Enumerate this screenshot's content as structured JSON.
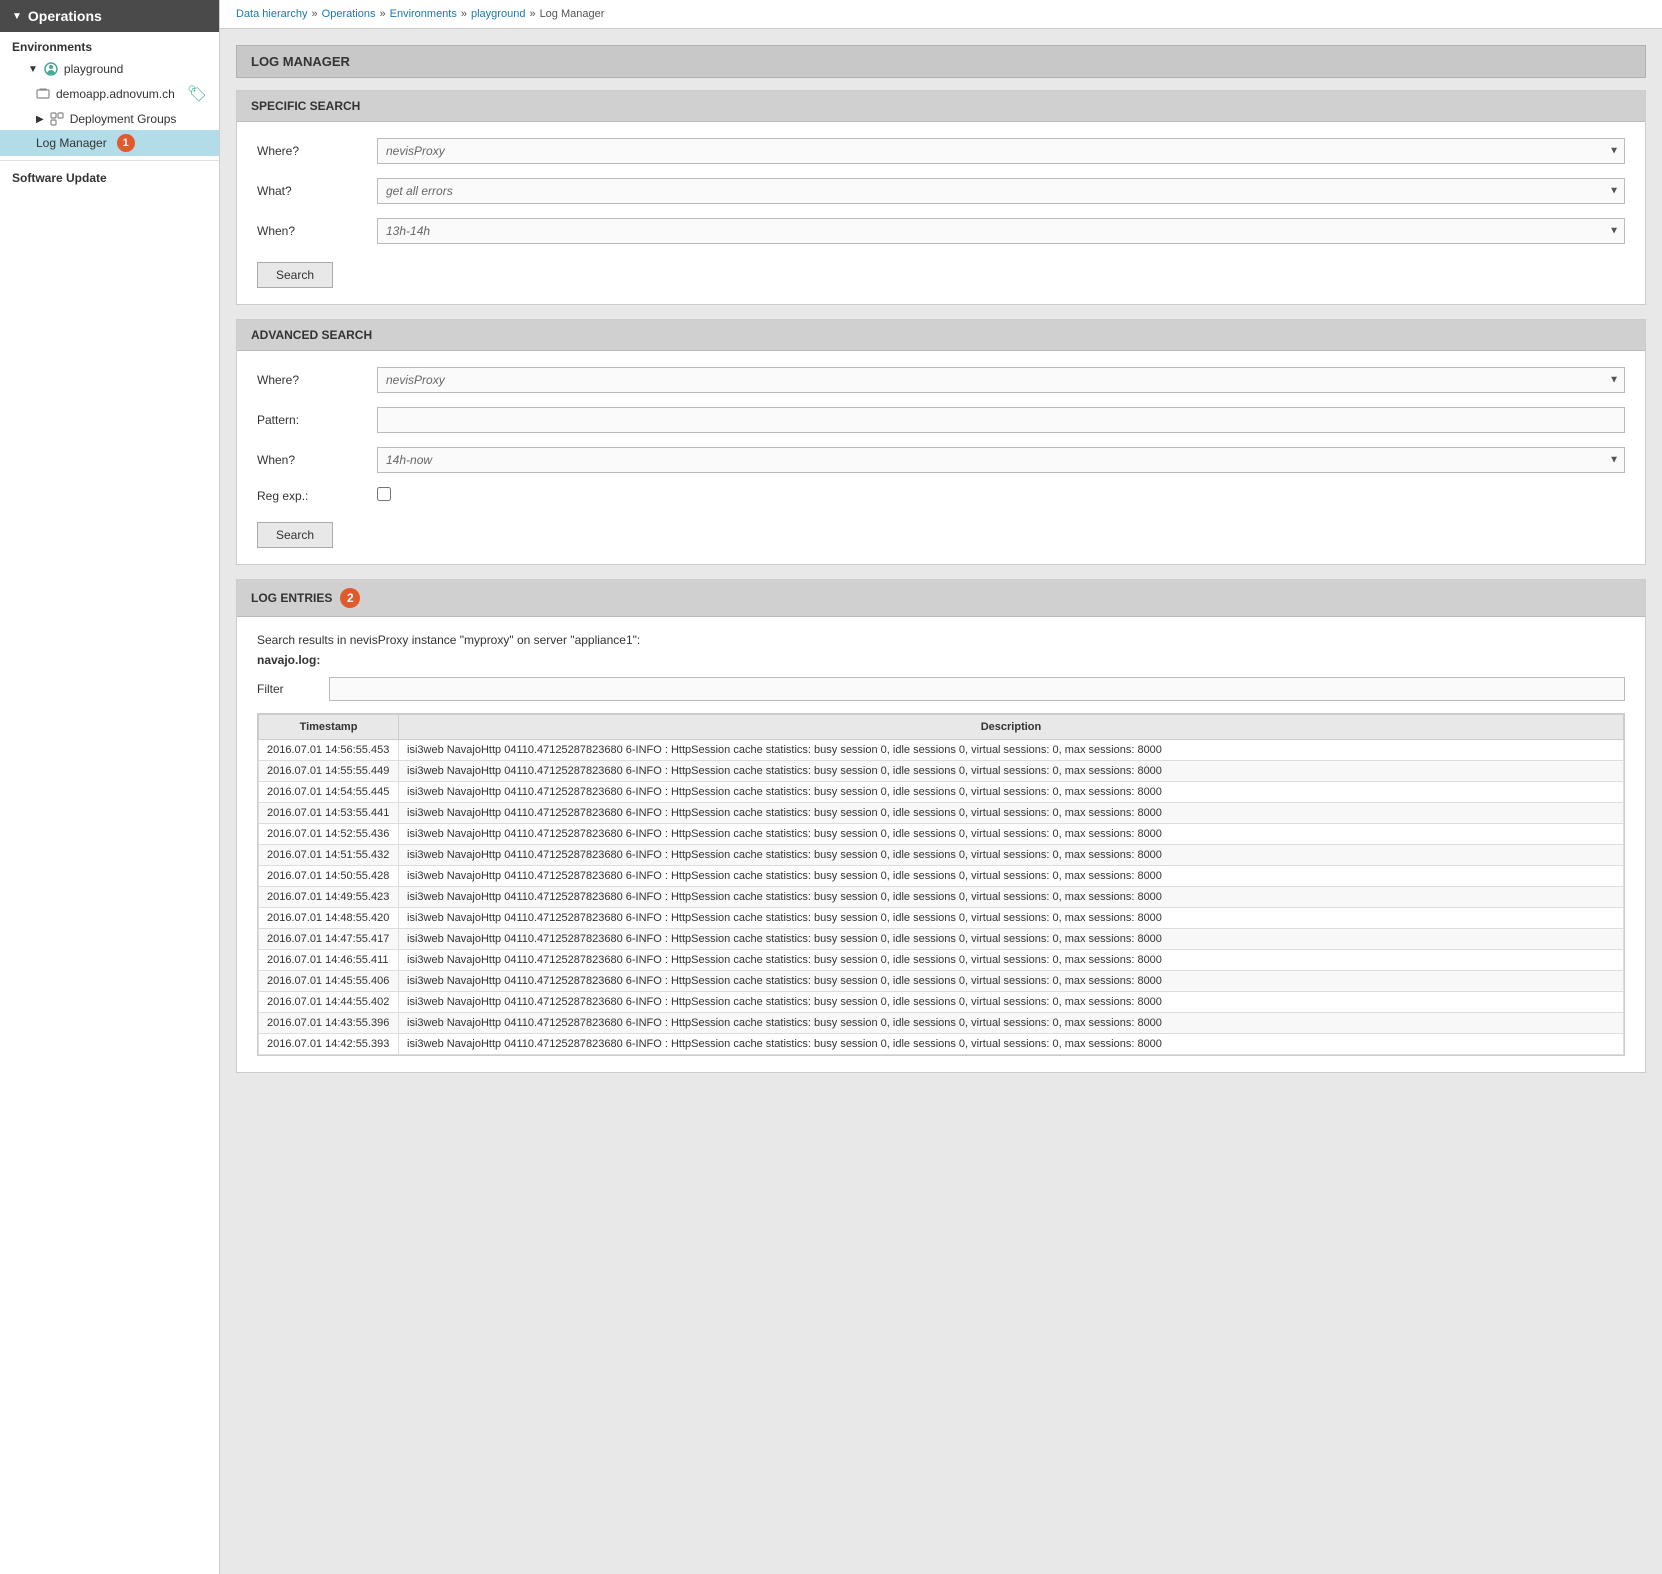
{
  "sidebar": {
    "header": "Operations",
    "environments_label": "Environments",
    "playground_label": "playground",
    "demoapp_label": "demoapp.adnovum.ch",
    "deployment_groups_label": "Deployment Groups",
    "log_manager_label": "Log Manager",
    "log_manager_badge": "1",
    "software_update_label": "Software Update"
  },
  "breadcrumb": {
    "data_hierarchy": "Data hierarchy",
    "operations": "Operations",
    "environments": "Environments",
    "playground": "playground",
    "log_manager": "Log Manager",
    "sep": "»"
  },
  "page_title": "LOG MANAGER",
  "specific_search": {
    "header": "SPECIFIC SEARCH",
    "where_label": "Where?",
    "where_value": "nevisProxy",
    "what_label": "What?",
    "what_value": "get all errors",
    "when_label": "When?",
    "when_value": "13h-14h",
    "search_btn": "Search"
  },
  "advanced_search": {
    "header": "ADVANCED SEARCH",
    "where_label": "Where?",
    "where_value": "nevisProxy",
    "pattern_label": "Pattern:",
    "pattern_value": "",
    "when_label": "When?",
    "when_value": "14h-now",
    "regexp_label": "Reg exp.:",
    "search_btn": "Search"
  },
  "log_entries": {
    "header": "LOG ENTRIES",
    "badge": "2",
    "summary": "Search results in nevisProxy instance \"myproxy\" on server \"appliance1\":",
    "filename": "navajo.log:",
    "filter_label": "Filter",
    "filter_placeholder": "",
    "table": {
      "col_timestamp": "Timestamp",
      "col_description": "Description",
      "rows": [
        {
          "ts": "2016.07.01 14:56:55.453",
          "desc": "isi3web NavajoHttp 04110.47125287823680 6-INFO : HttpSession cache statistics: busy session 0, idle sessions 0, virtual sessions: 0, max sessions: 8000"
        },
        {
          "ts": "2016.07.01 14:55:55.449",
          "desc": "isi3web NavajoHttp 04110.47125287823680 6-INFO : HttpSession cache statistics: busy session 0, idle sessions 0, virtual sessions: 0, max sessions: 8000"
        },
        {
          "ts": "2016.07.01 14:54:55.445",
          "desc": "isi3web NavajoHttp 04110.47125287823680 6-INFO : HttpSession cache statistics: busy session 0, idle sessions 0, virtual sessions: 0, max sessions: 8000"
        },
        {
          "ts": "2016.07.01 14:53:55.441",
          "desc": "isi3web NavajoHttp 04110.47125287823680 6-INFO : HttpSession cache statistics: busy session 0, idle sessions 0, virtual sessions: 0, max sessions: 8000"
        },
        {
          "ts": "2016.07.01 14:52:55.436",
          "desc": "isi3web NavajoHttp 04110.47125287823680 6-INFO : HttpSession cache statistics: busy session 0, idle sessions 0, virtual sessions: 0, max sessions: 8000"
        },
        {
          "ts": "2016.07.01 14:51:55.432",
          "desc": "isi3web NavajoHttp 04110.47125287823680 6-INFO : HttpSession cache statistics: busy session 0, idle sessions 0, virtual sessions: 0, max sessions: 8000"
        },
        {
          "ts": "2016.07.01 14:50:55.428",
          "desc": "isi3web NavajoHttp 04110.47125287823680 6-INFO : HttpSession cache statistics: busy session 0, idle sessions 0, virtual sessions: 0, max sessions: 8000"
        },
        {
          "ts": "2016.07.01 14:49:55.423",
          "desc": "isi3web NavajoHttp 04110.47125287823680 6-INFO : HttpSession cache statistics: busy session 0, idle sessions 0, virtual sessions: 0, max sessions: 8000"
        },
        {
          "ts": "2016.07.01 14:48:55.420",
          "desc": "isi3web NavajoHttp 04110.47125287823680 6-INFO : HttpSession cache statistics: busy session 0, idle sessions 0, virtual sessions: 0, max sessions: 8000"
        },
        {
          "ts": "2016.07.01 14:47:55.417",
          "desc": "isi3web NavajoHttp 04110.47125287823680 6-INFO : HttpSession cache statistics: busy session 0, idle sessions 0, virtual sessions: 0, max sessions: 8000"
        },
        {
          "ts": "2016.07.01 14:46:55.411",
          "desc": "isi3web NavajoHttp 04110.47125287823680 6-INFO : HttpSession cache statistics: busy session 0, idle sessions 0, virtual sessions: 0, max sessions: 8000"
        },
        {
          "ts": "2016.07.01 14:45:55.406",
          "desc": "isi3web NavajoHttp 04110.47125287823680 6-INFO : HttpSession cache statistics: busy session 0, idle sessions 0, virtual sessions: 0, max sessions: 8000"
        },
        {
          "ts": "2016.07.01 14:44:55.402",
          "desc": "isi3web NavajoHttp 04110.47125287823680 6-INFO : HttpSession cache statistics: busy session 0, idle sessions 0, virtual sessions: 0, max sessions: 8000"
        },
        {
          "ts": "2016.07.01 14:43:55.396",
          "desc": "isi3web NavajoHttp 04110.47125287823680 6-INFO : HttpSession cache statistics: busy session 0, idle sessions 0, virtual sessions: 0, max sessions: 8000"
        },
        {
          "ts": "2016.07.01 14:42:55.393",
          "desc": "isi3web NavajoHttp 04110.47125287823680 6-INFO : HttpSession cache statistics: busy session 0, idle sessions 0, virtual sessions: 0, max sessions: 8000"
        }
      ]
    }
  }
}
